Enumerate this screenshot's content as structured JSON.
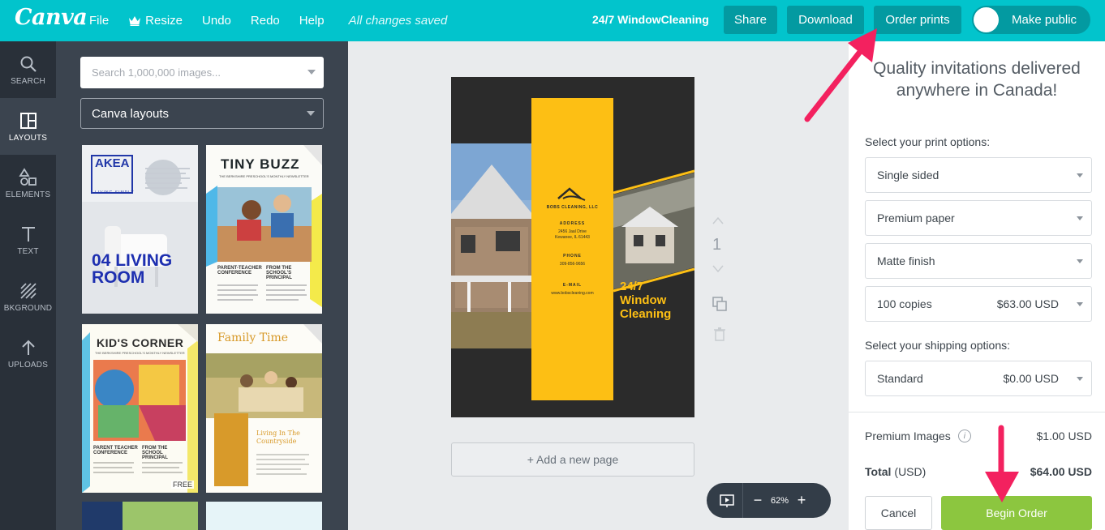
{
  "app": {
    "logo": "Canva",
    "menu": {
      "file": "File",
      "resize": "Resize",
      "undo": "Undo",
      "redo": "Redo",
      "help": "Help",
      "saved_status": "All changes saved"
    },
    "document_title": "24/7 WindowCleaning",
    "buttons": {
      "share": "Share",
      "download": "Download",
      "order_prints": "Order prints",
      "make_public": "Make public"
    }
  },
  "rail": [
    {
      "label": "SEARCH",
      "icon": "magnifier-icon"
    },
    {
      "label": "LAYOUTS",
      "icon": "layouts-icon",
      "active": true
    },
    {
      "label": "ELEMENTS",
      "icon": "shapes-icon"
    },
    {
      "label": "TEXT",
      "icon": "text-t-icon"
    },
    {
      "label": "BKGROUND",
      "icon": "diagonal-stripes-icon"
    },
    {
      "label": "UPLOADS",
      "icon": "upload-arrow-icon"
    }
  ],
  "panel": {
    "search_placeholder": "Search 1,000,000 images...",
    "layouts_select": "Canva layouts",
    "thumbs": [
      {
        "title": "AKEA",
        "sub": "LIVING SIMPLY",
        "big": "04 LIVING ROOM"
      },
      {
        "title": "TINY BUZZ",
        "sub": "THE BERKSHIRE PRESCHOOL'S MONTHLY NEWSLETTER",
        "col1": "PARENT-TEACHER CONFERENCE",
        "col2": "FROM THE SCHOOL'S PRINCIPAL"
      },
      {
        "title": "KID'S CORNER",
        "sub": "THE BERKSHIRE PRESCHOOL'S MONTHLY NEWSLETTER",
        "col1": "PARENT TEACHER CONFERENCE",
        "col2": "FROM THE SCHOOL PRINCIPAL",
        "badge": "FREE"
      },
      {
        "title": "Family Time",
        "col1": "Living In The Countryside"
      }
    ]
  },
  "design": {
    "company": "BOBS CLEANING, LLC",
    "address_label": "ADDRESS",
    "address_line1": "2456 Jaal Drive",
    "address_line2": "Kewanee, IL 61443",
    "phone_label": "PHONE",
    "phone": "309-856-9656",
    "email_label": "E-MAIL",
    "email": "www.bobscleaning.com",
    "headline_1": "24/7",
    "headline_2": "Window",
    "headline_3": "Cleaning",
    "colors": {
      "accent": "#fdbf14",
      "background": "#2b2b2b"
    }
  },
  "canvas": {
    "page_number": "1",
    "add_page": "+ Add a new page",
    "zoom": "62%",
    "zoom_minus": "−",
    "zoom_plus": "+"
  },
  "order": {
    "heading": "Quality invitations delivered anywhere in Canada!",
    "print_options_label": "Select your print options:",
    "sided": "Single sided",
    "paper": "Premium paper",
    "finish": "Matte finish",
    "copies": "100 copies",
    "copies_price": "$63.00 USD",
    "shipping_label": "Select your shipping options:",
    "shipping": "Standard",
    "shipping_price": "$0.00 USD",
    "premium_images_label": "Premium Images",
    "premium_images_price": "$1.00 USD",
    "total_label": "Total",
    "total_currency": "(USD)",
    "total_price": "$64.00 USD",
    "cancel": "Cancel",
    "begin": "Begin Order"
  }
}
